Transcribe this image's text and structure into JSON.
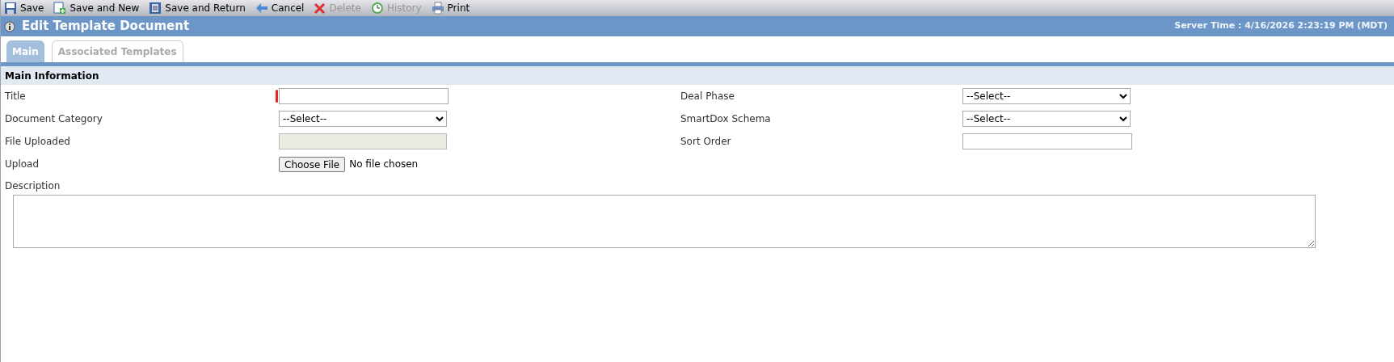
{
  "toolbar": [
    {
      "kind": "save",
      "label": "Save",
      "disabled": false
    },
    {
      "kind": "save-new",
      "label": "Save and New",
      "disabled": false
    },
    {
      "kind": "save-return",
      "label": "Save and Return",
      "disabled": false
    },
    {
      "kind": "cancel",
      "label": "Cancel",
      "disabled": false
    },
    {
      "kind": "delete",
      "label": "Delete",
      "disabled": true
    },
    {
      "kind": "history",
      "label": "History",
      "disabled": true
    },
    {
      "kind": "print",
      "label": "Print",
      "disabled": false
    }
  ],
  "header": {
    "title": "Edit Template Document",
    "server_time": "Server Time : 4/16/2026 2:23:19 PM (MDT)"
  },
  "tabs": [
    {
      "label": "Main",
      "selected": true
    },
    {
      "label": "Associated Templates",
      "selected": false
    }
  ],
  "section": {
    "title": "Main Information"
  },
  "left_fields": [
    {
      "kind": "text",
      "label": "Title",
      "required": true
    },
    {
      "kind": "select",
      "label": "Document Category",
      "value": "--Select--",
      "required": false
    },
    {
      "kind": "readonly",
      "label": "File Uploaded",
      "required": false
    },
    {
      "kind": "file",
      "label": "Upload",
      "button": "Choose File",
      "value": "No file chosen",
      "required": false
    }
  ],
  "right_fields": [
    {
      "kind": "select",
      "label": "Deal Phase",
      "value": "--Select--",
      "required": false
    },
    {
      "kind": "select",
      "label": "SmartDox Schema",
      "value": "--Select--",
      "required": false
    },
    {
      "kind": "text",
      "label": "Sort Order",
      "required": false
    }
  ],
  "description": {
    "label": "Description"
  }
}
